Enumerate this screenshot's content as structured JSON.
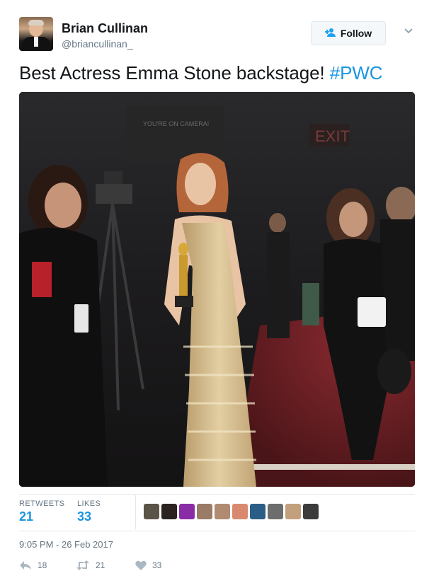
{
  "author": {
    "name": "Brian Cullinan",
    "handle": "@briancullinan_"
  },
  "follow_button": {
    "label": "Follow",
    "icon": "add-user-icon"
  },
  "menu": {
    "icon": "chevron-down-icon"
  },
  "tweet": {
    "text": "Best Actress Emma Stone backstage! ",
    "hashtag": "#PWC"
  },
  "photo": {
    "alt": "Emma Stone holding an Oscar backstage",
    "signs": [
      "YOU'RE ON CAMERA!",
      "EXIT"
    ]
  },
  "stats": {
    "retweets_label": "RETWEETS",
    "retweets_value": "21",
    "likes_label": "LIKES",
    "likes_value": "33"
  },
  "likers": [
    {
      "color": "#5a5347"
    },
    {
      "color": "#2a2320"
    },
    {
      "color": "#8a2ca6"
    },
    {
      "color": "#9a7b66"
    },
    {
      "color": "#b08b72"
    },
    {
      "color": "#d98a6e"
    },
    {
      "color": "#2b5e86"
    },
    {
      "color": "#6d6d6d"
    },
    {
      "color": "#c2a07c"
    },
    {
      "color": "#3b3b3b"
    }
  ],
  "timestamp": "9:05 PM - 26 Feb 2017",
  "actions": {
    "reply_count": "18",
    "retweet_count": "21",
    "like_count": "33"
  },
  "colors": {
    "link": "#1b95e0",
    "muted": "#657786",
    "border": "#e1e8ed"
  }
}
